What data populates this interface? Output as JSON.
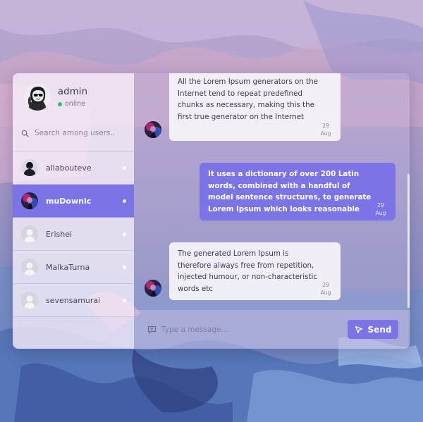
{
  "profile": {
    "name": "admin",
    "status": "online",
    "status_color": "#22c55e",
    "avatar_icon": "user-sunglasses-avatar"
  },
  "search": {
    "placeholder": "Search among users..",
    "icon": "search-icon"
  },
  "users": [
    {
      "name": "allabouteve",
      "active": false,
      "avatar": "photo-avatar"
    },
    {
      "name": "muDownic",
      "active": true,
      "avatar": "photo-avatar"
    },
    {
      "name": "Erishei",
      "active": false,
      "avatar": "default-user-avatar"
    },
    {
      "name": "MalkaTurna",
      "active": false,
      "avatar": "default-user-avatar"
    },
    {
      "name": "sevensamurai",
      "active": false,
      "avatar": "default-user-avatar"
    }
  ],
  "messages": [
    {
      "direction": "incoming",
      "text": "All the Lorem Ipsum generators on the Internet tend to repeat predefined chunks as necessary, making this the first true generator on the Internet",
      "date_day": "29",
      "date_month": "Aug"
    },
    {
      "direction": "outgoing",
      "text": "It uses a dictionary of over 200 Latin words, combined with a handful of model sentence structures, to generate Lorem Ipsum which looks reasonable",
      "date_day": "29",
      "date_month": "Aug"
    },
    {
      "direction": "incoming",
      "text": "The generated Lorem Ipsum is therefore always free from repetition, injected humour, or non-characteristic words etc",
      "date_day": "29",
      "date_month": "Aug"
    }
  ],
  "composer": {
    "placeholder": "Type a message...",
    "send_label": "Send",
    "send_icon": "send-arrow-icon",
    "message_icon": "message-icon"
  },
  "colors": {
    "accent": "#7b73e8",
    "online": "#22c55e"
  }
}
